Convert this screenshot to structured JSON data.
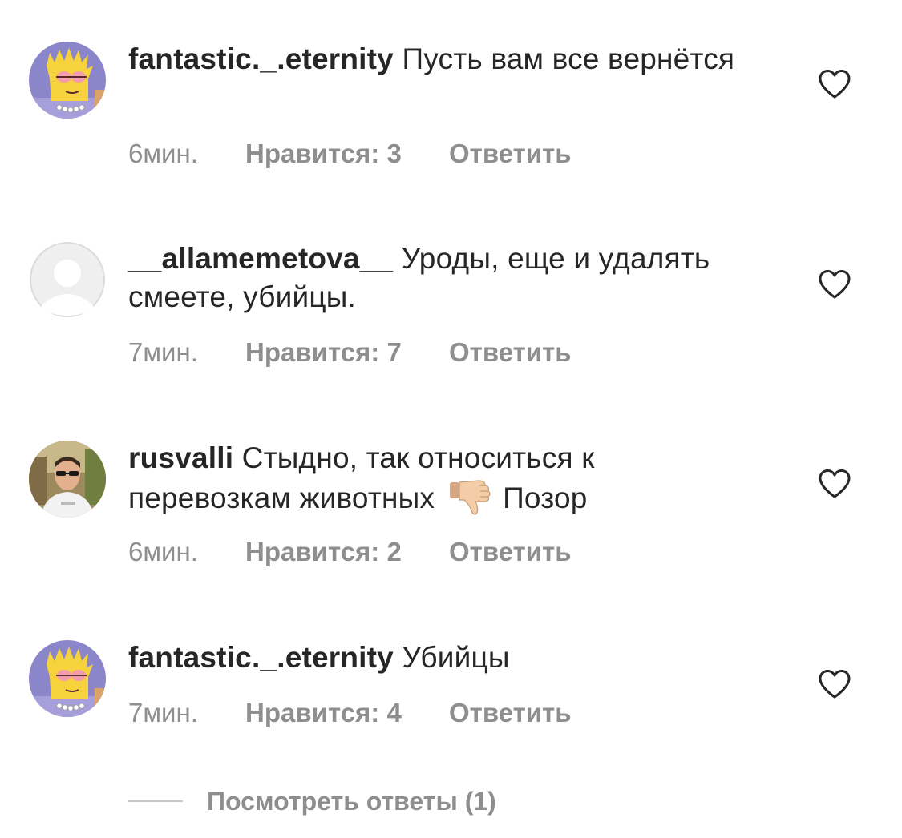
{
  "comments": [
    {
      "username": "fantastic._.eternity",
      "text": "Пусть вам все вернётся",
      "time": "6мин.",
      "likes": "Нравится: 3",
      "reply": "Ответить",
      "avatar": "lisa-simpson-avatar"
    },
    {
      "username": "__allamemetova__",
      "text": "Уроды, еще и удалять смеете, убийцы.",
      "time": "7мин.",
      "likes": "Нравится: 7",
      "reply": "Ответить",
      "avatar": "default-avatar"
    },
    {
      "username": "rusvalli",
      "text_before": "Стыдно, так относиться к перевозкам животных",
      "emoji": "thumbs-down-emoji",
      "text_after": "Позор",
      "time": "6мин.",
      "likes": "Нравится: 2",
      "reply": "Ответить",
      "avatar": "man-photo-avatar"
    },
    {
      "username": "fantastic._.eternity",
      "text": "Убийцы",
      "time": "7мин.",
      "likes": "Нравится: 4",
      "reply": "Ответить",
      "avatar": "lisa-simpson-avatar"
    }
  ],
  "view_replies": "Посмотреть ответы (1)",
  "colors": {
    "text": "#262626",
    "secondary": "#8e8e8e",
    "divider": "#c7c7c7"
  }
}
